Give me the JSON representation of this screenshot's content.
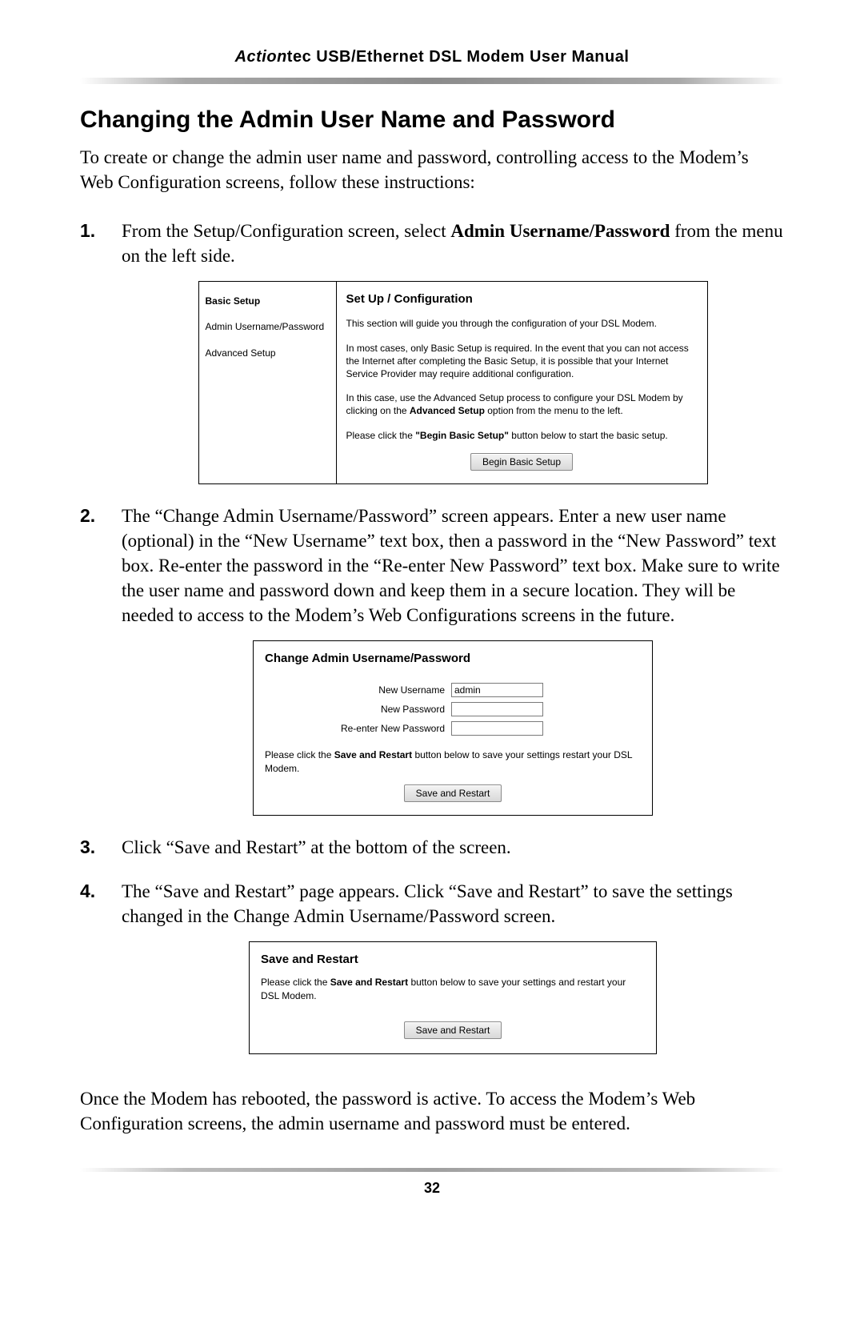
{
  "header": {
    "brand_italic": "Action",
    "brand_rest": "tec",
    "title_rest": " USB/Ethernet DSL Modem User Manual"
  },
  "section_title": "Changing the Admin User Name and Password",
  "intro": "To create or change the admin user name and password, controlling access to the Modem’s Web Configuration screens, follow these instructions:",
  "step1": {
    "pre": "From the Setup/Configuration screen, select ",
    "bold": "Admin Username/Password",
    "post": " from the menu on the left side."
  },
  "panel1": {
    "sidebar": {
      "items": [
        "Basic Setup",
        "Admin Username/Password",
        "Advanced Setup"
      ]
    },
    "title": "Set Up / Configuration",
    "p1": "This section will guide you through the configuration of your DSL Modem.",
    "p2": "In most cases, only Basic Setup is required. In the event that you can not access the Internet after completing the Basic Setup, it is possible that your Internet Service Provider may require additional configuration.",
    "p3_pre": "In this case, use the Advanced Setup process to configure your DSL Modem by clicking on the ",
    "p3_bold": "Advanced Setup",
    "p3_post": " option from the menu to the left.",
    "p4_pre": "Please click the ",
    "p4_bold": "\"Begin Basic Setup\"",
    "p4_post": " button below to start the basic setup.",
    "button": "Begin Basic Setup"
  },
  "step2": "The “Change Admin Username/Password” screen appears. Enter a new user name (optional) in the “New Username” text box, then a password in the “New Password” text box. Re-enter the password in the “Re-enter New Password” text box. Make sure to write the user name and password down and keep them in a secure location. They will be needed to access to the Modem’s Web Configurations screens in the future.",
  "panel2": {
    "title": "Change Admin Username/Password",
    "labels": {
      "username": "New Username",
      "password": "New Password",
      "reenter": "Re-enter New Password"
    },
    "values": {
      "username": "admin",
      "password": "",
      "reenter": ""
    },
    "note_pre": "Please click the ",
    "note_bold": "Save and Restart",
    "note_post": " button below to save your settings restart your DSL Modem.",
    "button": "Save and Restart"
  },
  "step3": "Click “Save and Restart” at the bottom of the screen.",
  "step4": "The “Save and Restart” page appears. Click “Save and Restart” to save the settings changed in the Change Admin Username/Password screen.",
  "panel3": {
    "title": "Save and Restart",
    "note_pre": "Please click the ",
    "note_bold": "Save and Restart",
    "note_post": " button below to save your settings and restart your DSL Modem.",
    "button": "Save and Restart"
  },
  "closing": "Once the Modem has rebooted, the password is active. To access the Modem’s Web Configuration screens, the admin username and password must be entered.",
  "page_number": "32"
}
